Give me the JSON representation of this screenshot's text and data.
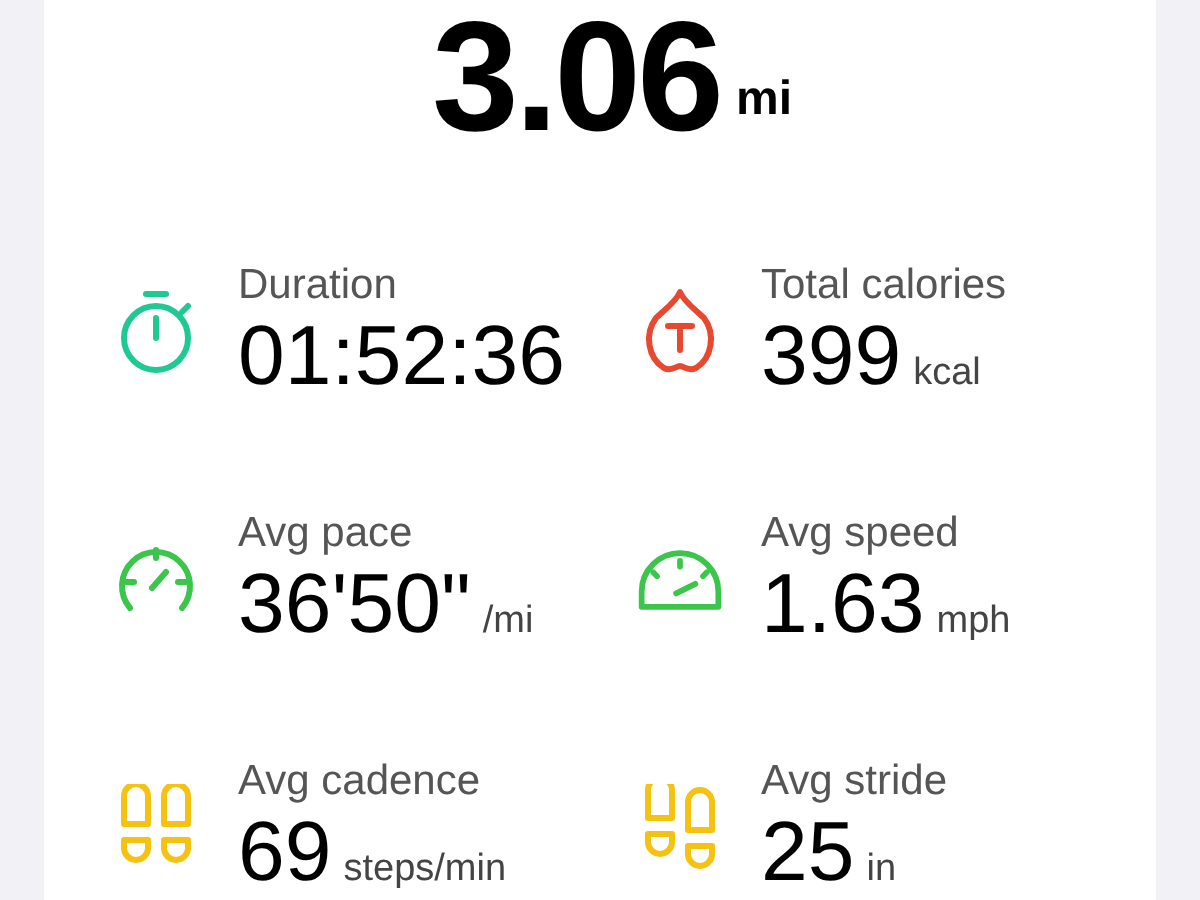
{
  "distance": {
    "value": "3.06",
    "unit": "mi"
  },
  "stats": [
    {
      "label": "Duration",
      "value": "01:52:36"
    },
    {
      "label": "Total calories",
      "value": "399",
      "unit": "kcal"
    },
    {
      "label": "Avg pace",
      "value": "36'50\"",
      "unit": "/mi"
    },
    {
      "label": "Avg speed",
      "value": "1.63",
      "unit": "mph"
    },
    {
      "label": "Avg cadence",
      "value": "69",
      "unit": "steps/min"
    },
    {
      "label": "Avg stride",
      "value": "25",
      "unit": "in"
    }
  ]
}
